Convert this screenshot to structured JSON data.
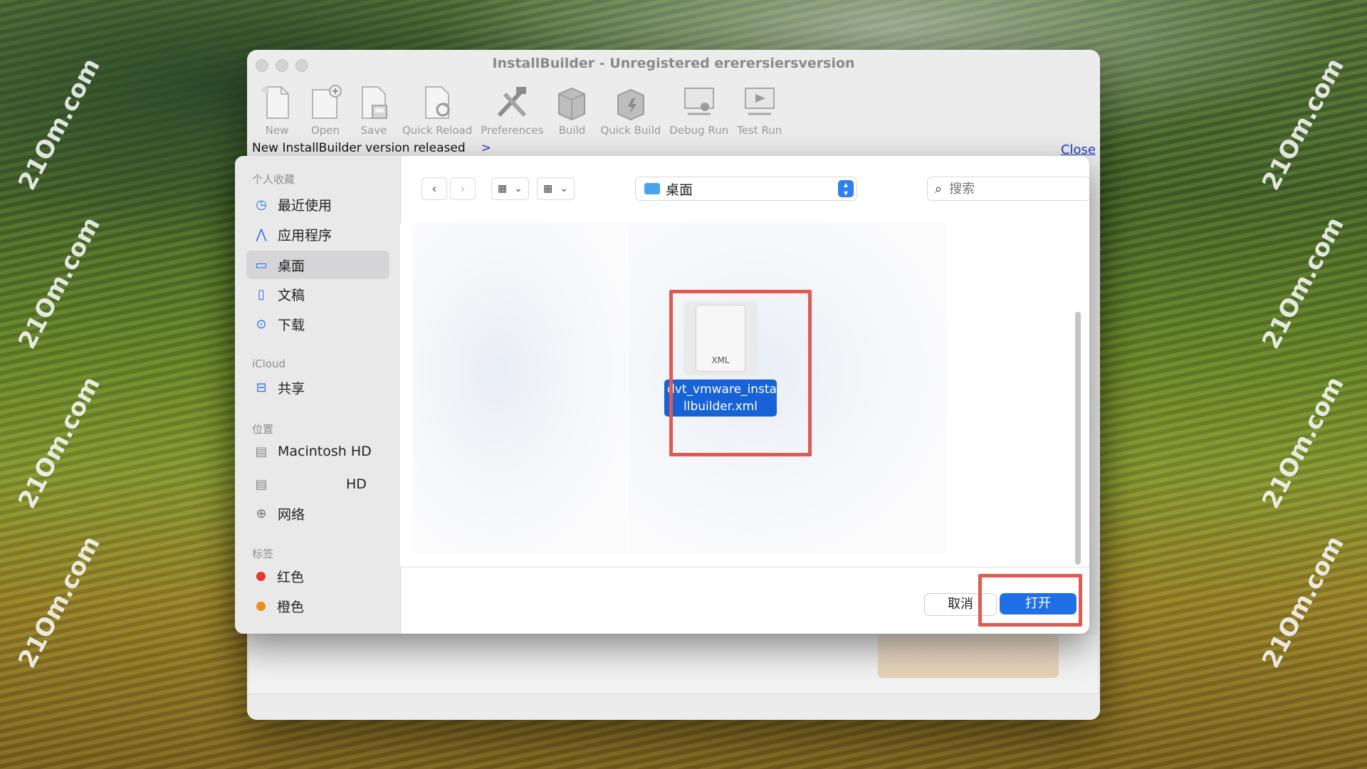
{
  "watermark": "21Om.com",
  "app": {
    "title": "InstallBuilder - Unregistered ererersiersversion",
    "toolbar": [
      {
        "label": "New",
        "icon": "new-document-icon"
      },
      {
        "label": "Open",
        "icon": "open-document-icon"
      },
      {
        "label": "Save",
        "icon": "save-icon"
      },
      {
        "label": "Quick Reload",
        "icon": "quick-reload-icon"
      },
      {
        "label": "Preferences",
        "icon": "preferences-tools-icon"
      },
      {
        "label": "Build",
        "icon": "build-icon"
      },
      {
        "label": "Quick Build",
        "icon": "quick-build-icon"
      },
      {
        "label": "Debug Run",
        "icon": "debug-run-icon"
      },
      {
        "label": "Test Run",
        "icon": "test-run-icon"
      }
    ],
    "notice": "New InstallBuilder version released",
    "notice_arrow": ">",
    "close_label": "Close"
  },
  "dialog": {
    "sidebar": {
      "favorites_heading": "个人收藏",
      "favorites": [
        {
          "label": "最近使用",
          "icon": "clock-icon"
        },
        {
          "label": "应用程序",
          "icon": "applications-icon"
        },
        {
          "label": "桌面",
          "icon": "desktop-icon",
          "selected": true
        },
        {
          "label": "文稿",
          "icon": "document-icon"
        },
        {
          "label": "下载",
          "icon": "download-icon"
        }
      ],
      "icloud_heading": "iCloud",
      "icloud": [
        {
          "label": "共享",
          "icon": "shared-folder-icon"
        }
      ],
      "locations_heading": "位置",
      "locations": [
        {
          "label": "Macintosh HD",
          "icon": "disk-icon"
        },
        {
          "label": "HD",
          "icon": "disk-icon"
        },
        {
          "label": "网络",
          "icon": "network-globe-icon"
        }
      ],
      "tags_heading": "标签",
      "tags": [
        {
          "label": "红色",
          "color": "#e8372f"
        },
        {
          "label": "橙色",
          "color": "#f28a1d"
        }
      ]
    },
    "path": "桌面",
    "search_placeholder": "搜索",
    "file": {
      "type_label": "XML",
      "name_line1": "dvt_vmware_insta",
      "name_line2": "llbuilder.xml"
    },
    "cancel_label": "取消",
    "open_label": "打开"
  },
  "colors": {
    "accent": "#1f6fe6",
    "selection": "#1662d6",
    "highlight_box": "#e05a52"
  }
}
